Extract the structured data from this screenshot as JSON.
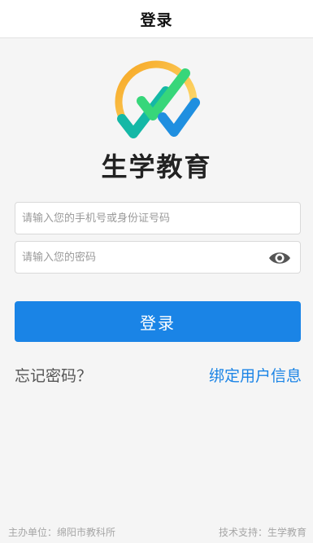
{
  "header": {
    "title": "登录"
  },
  "brand": {
    "name": "生学教育",
    "colors": {
      "arc": "#f7c948",
      "check_green": "#37d67a",
      "check_teal": "#14b8a6",
      "check_blue": "#1f8fe0"
    }
  },
  "form": {
    "phone_placeholder": "请输入您的手机号或身份证号码",
    "phone_value": "",
    "password_placeholder": "请输入您的密码",
    "password_value": "",
    "eye_icon": "eye-icon"
  },
  "actions": {
    "login_label": "登录",
    "forgot_label": "忘记密码？",
    "bind_label": "绑定用户信息"
  },
  "footer": {
    "left": "主办单位：绵阳市教科所",
    "right": "技术支持：生学教育"
  },
  "colors": {
    "accent": "#1a84e6",
    "background": "#f5f5f5"
  }
}
